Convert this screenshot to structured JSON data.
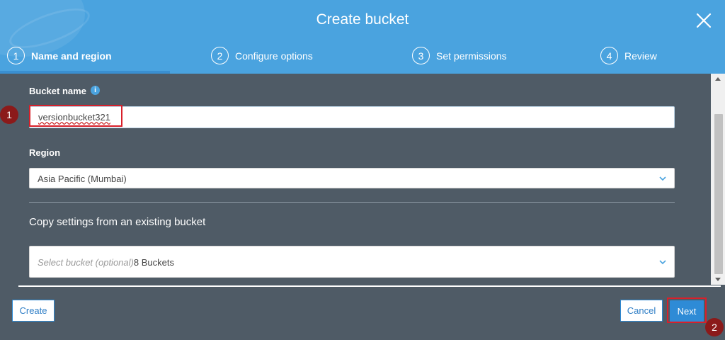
{
  "header": {
    "title": "Create bucket",
    "close_icon": "close-icon"
  },
  "steps": [
    {
      "number": "1",
      "label": "Name and region",
      "active": true
    },
    {
      "number": "2",
      "label": "Configure options",
      "active": false
    },
    {
      "number": "3",
      "label": "Set permissions",
      "active": false
    },
    {
      "number": "4",
      "label": "Review",
      "active": false
    }
  ],
  "bucket_name": {
    "label": "Bucket name",
    "info_icon": "info-icon",
    "value": "versionbucket321"
  },
  "region": {
    "label": "Region",
    "selected": "Asia Pacific (Mumbai)"
  },
  "copy_settings": {
    "heading": "Copy settings from an existing bucket",
    "placeholder": "Select bucket (optional)",
    "count": "8 Buckets"
  },
  "buttons": {
    "create": "Create",
    "cancel": "Cancel",
    "next": "Next"
  },
  "annotations": {
    "marker_1": "1",
    "marker_2": "2"
  },
  "colors": {
    "header": "#4aa3df",
    "body": "#4f5b66",
    "primary": "#2e8bd6",
    "highlight": "#d8202a",
    "marker": "#8b1a1a"
  }
}
